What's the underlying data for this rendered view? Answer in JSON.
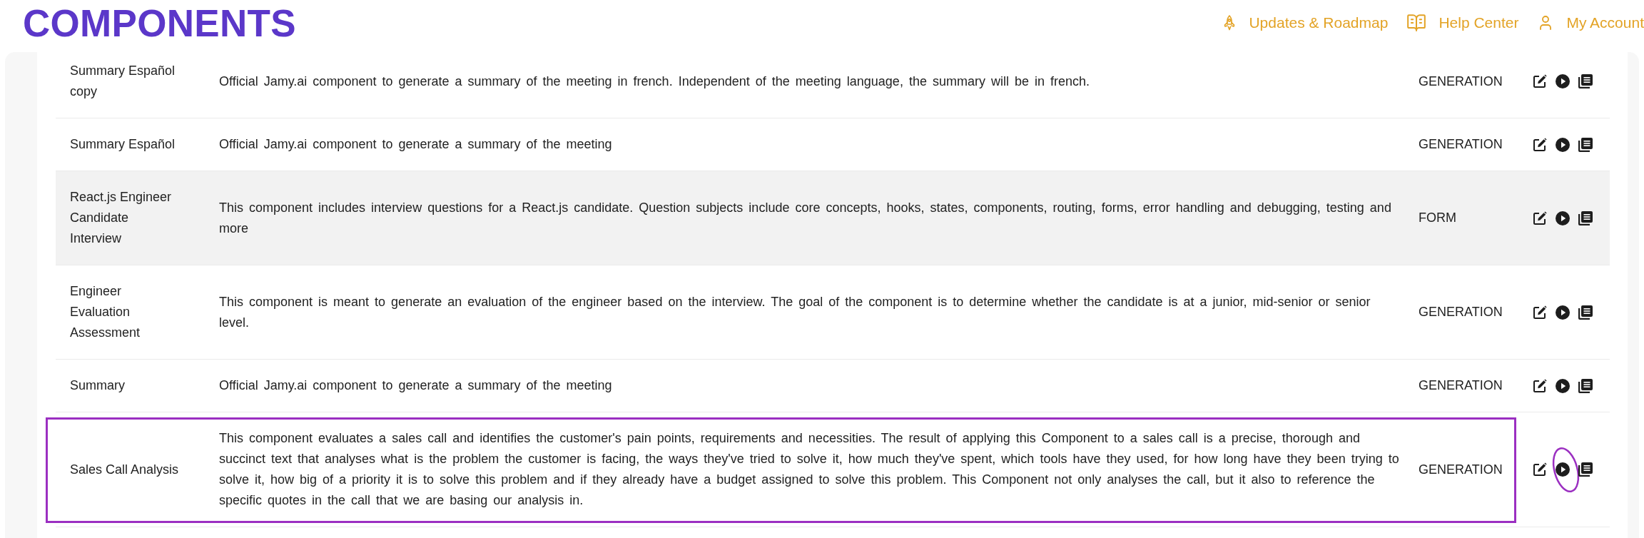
{
  "header": {
    "title": "COMPONENTS",
    "links": [
      {
        "kind": "updates",
        "label": "Updates & Roadmap"
      },
      {
        "kind": "help",
        "label": "Help Center"
      },
      {
        "kind": "account",
        "label": "My Account"
      }
    ]
  },
  "table": {
    "rows": [
      {
        "name": "Summary Español copy",
        "description": "Official Jamy.ai component to generate a summary of the meeting in french. Independent of the meeting language, the summary will be in french.",
        "type": "GENERATION",
        "hovered": false,
        "outlined": false,
        "play_circled": false
      },
      {
        "name": "Summary Español",
        "description": "Official Jamy.ai component to generate a summary of the meeting",
        "type": "GENERATION",
        "hovered": false,
        "outlined": false,
        "play_circled": false
      },
      {
        "name": "React.js Engineer Candidate Interview",
        "description": "This component includes interview questions for a React.js candidate. Question subjects include core concepts, hooks, states, components, routing, forms, error handling and debugging, testing and more",
        "type": "FORM",
        "hovered": true,
        "outlined": false,
        "play_circled": false
      },
      {
        "name": "Engineer Evaluation Assessment",
        "description": "This component is meant to generate an evaluation of the engineer based on the interview. The goal of the component is to determine whether the candidate is at a junior, mid-senior or senior level.",
        "type": "GENERATION",
        "hovered": false,
        "outlined": false,
        "play_circled": false
      },
      {
        "name": "Summary",
        "description": "Official Jamy.ai component to generate a summary of the meeting",
        "type": "GENERATION",
        "hovered": false,
        "outlined": false,
        "play_circled": false
      },
      {
        "name": "Sales Call Analysis",
        "description": "This component evaluates a sales call and identifies the customer's pain points, requirements and necessities. The result of applying this Component to a sales call is a precise, thorough and succinct text that analyses what is the problem the customer is facing, the ways they've tried to solve it, how much they've spent, which tools have they used, for how long have they been trying to solve it, how big of a priority it is to solve this problem and if they already have a budget assigned to solve this problem. This Component not only analyses the call, but it also to reference the specific quotes in the call that we are basing our analysis in.",
        "type": "GENERATION",
        "hovered": false,
        "outlined": true,
        "play_circled": true
      }
    ]
  }
}
